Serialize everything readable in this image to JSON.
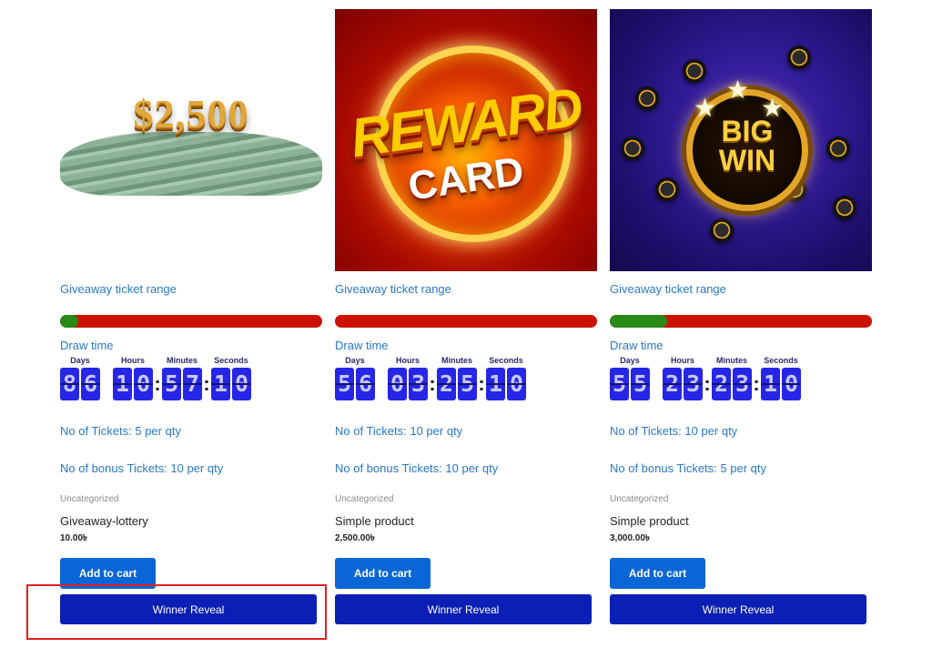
{
  "labels": {
    "range": "Giveaway ticket range",
    "draw_time": "Draw time",
    "days": "Days",
    "hours": "Hours",
    "minutes": "Minutes",
    "seconds": "Seconds",
    "add_to_cart": "Add to cart",
    "winner_reveal": "Winner Reveal"
  },
  "products": [
    {
      "image_text": "$2,500",
      "progress_fraction": 0.07,
      "countdown": {
        "days": "86",
        "hours": "10",
        "minutes": "57",
        "seconds": "10"
      },
      "tickets": "No of Tickets: 5 per qty",
      "bonus": "No of bonus Tickets: 10 per qty",
      "category": "Uncategorized",
      "title": "Giveaway-lottery",
      "price": "10.00৳"
    },
    {
      "image_text_top": "REWARD",
      "image_text_bottom": "CARD",
      "progress_fraction": 0.0,
      "countdown": {
        "days": "56",
        "hours": "03",
        "minutes": "25",
        "seconds": "10"
      },
      "tickets": "No of Tickets: 10 per qty",
      "bonus": "No of bonus Tickets: 10 per qty",
      "category": "Uncategorized",
      "title": "Simple product",
      "price": "2,500.00৳"
    },
    {
      "image_text_top": "BIG",
      "image_text_bottom": "WIN",
      "progress_fraction": 0.22,
      "countdown": {
        "days": "55",
        "hours": "23",
        "minutes": "23",
        "seconds": "10"
      },
      "tickets": "No of Tickets: 10 per qty",
      "bonus": "No of bonus Tickets: 5 per qty",
      "category": "Uncategorized",
      "title": "Simple product",
      "price": "3,000.00৳"
    }
  ],
  "colors": {
    "link": "#2a78c8",
    "progress_empty": "#cc1100",
    "progress_fill": "#2a8a17",
    "digit_bg": "#2626e6",
    "cart_button": "#0a66d6",
    "reveal_button": "#0a1fb3",
    "highlight": "#e02020"
  }
}
